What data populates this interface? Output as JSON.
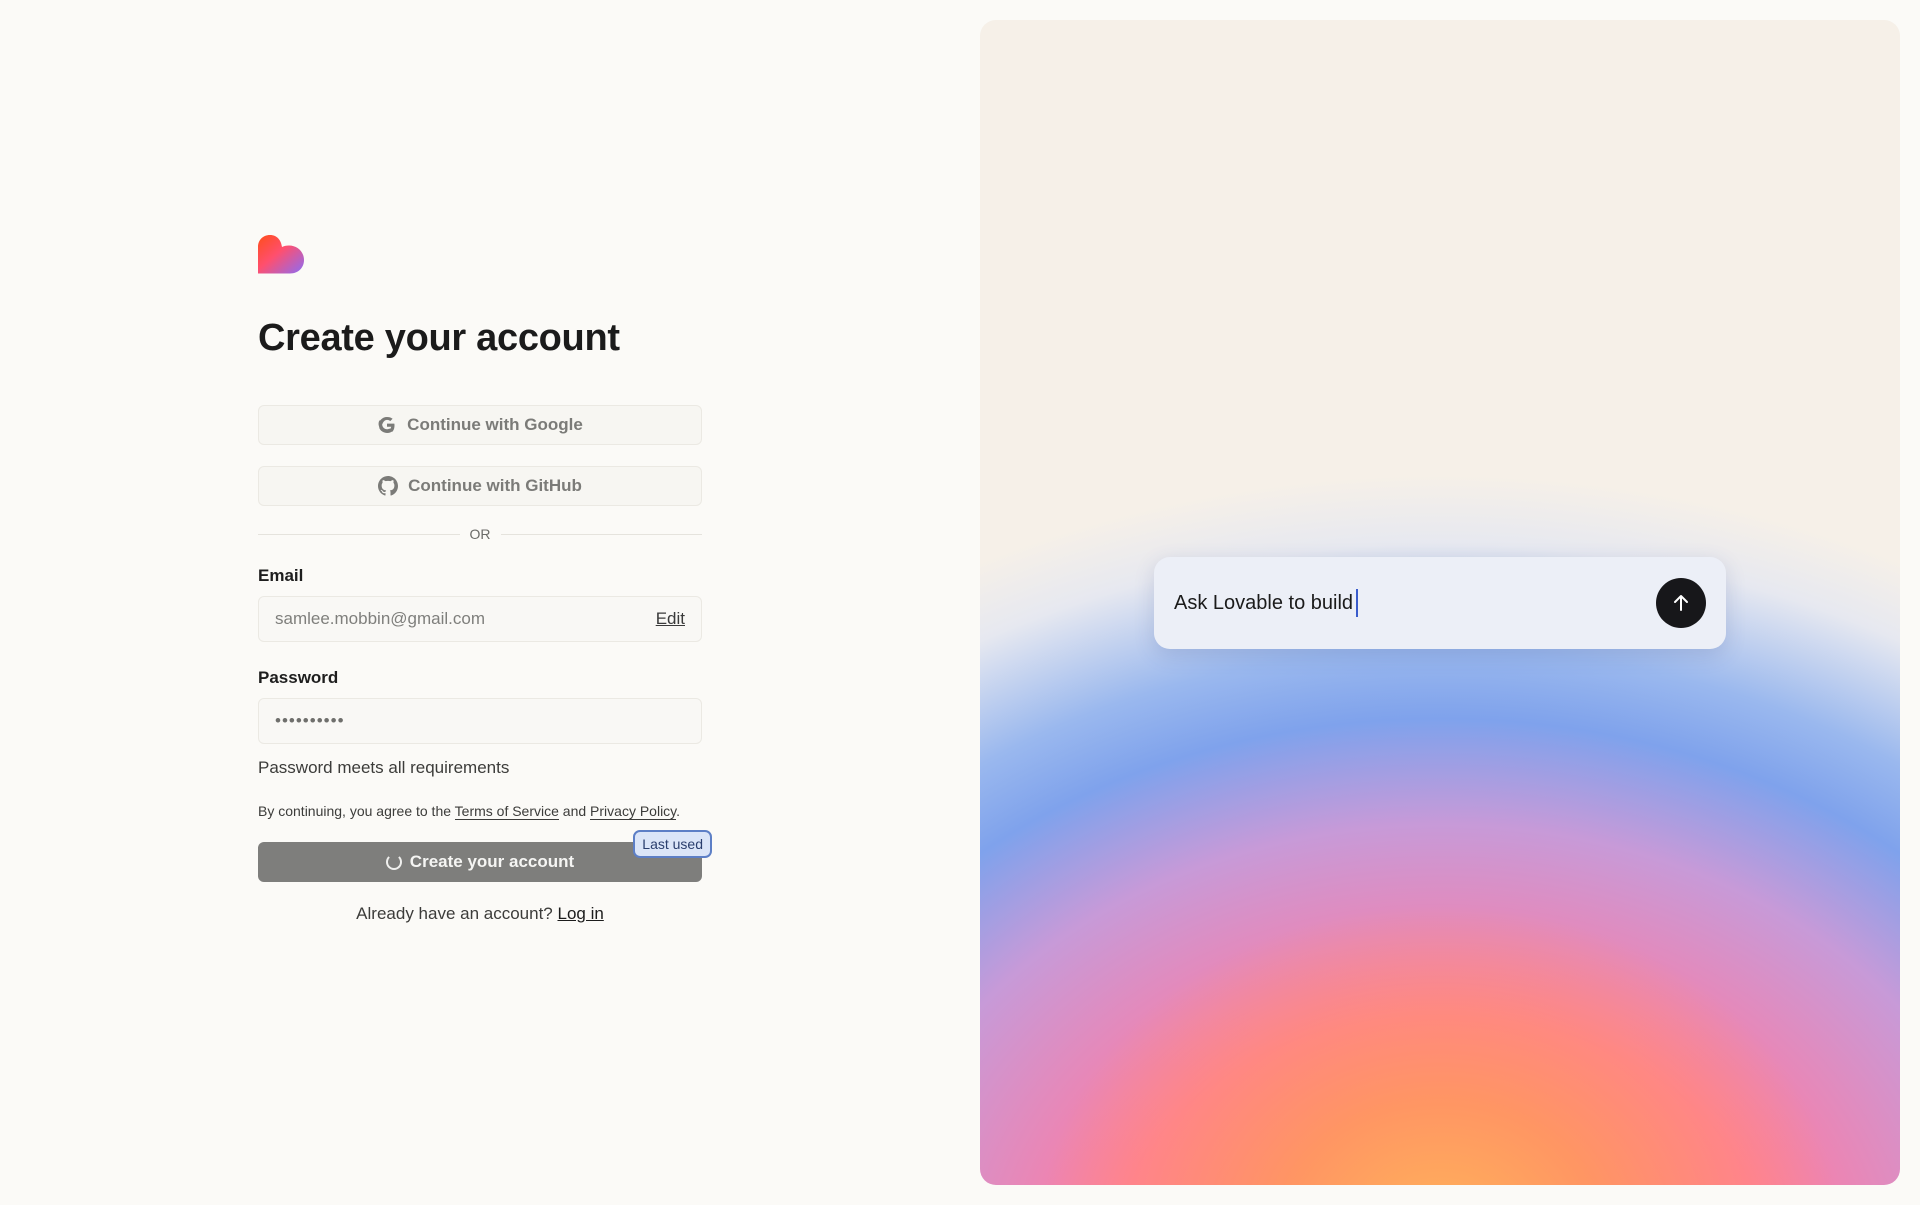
{
  "brand": {
    "logo_icon": "lovable-heart-icon"
  },
  "page": {
    "title": "Create your account"
  },
  "social": {
    "google_label": "Continue with Google",
    "google_icon": "google-icon",
    "github_label": "Continue with GitHub",
    "github_icon": "github-icon"
  },
  "divider": {
    "text": "OR"
  },
  "email": {
    "label": "Email",
    "value": "samlee.mobbin@gmail.com",
    "edit_label": "Edit"
  },
  "password": {
    "label": "Password",
    "value_masked": "••••••••••",
    "requirement_text": "Password meets all requirements"
  },
  "terms": {
    "prefix": "By continuing, you agree to the ",
    "tos_link": "Terms of Service",
    "and": " and ",
    "privacy_link": "Privacy Policy",
    "suffix": "."
  },
  "submit": {
    "label": "Create your account",
    "badge": "Last used",
    "icon": "spinner-icon"
  },
  "login": {
    "prompt": "Already have an account? ",
    "link": "Log in"
  },
  "hero": {
    "prompt_text": "Ask Lovable to build",
    "send_icon": "arrow-up-icon"
  },
  "colors": {
    "page_bg": "#fbfaf7",
    "button_disabled": "#7e7e7c",
    "badge_border": "#5d7fc6",
    "send_bg": "#17171a"
  }
}
